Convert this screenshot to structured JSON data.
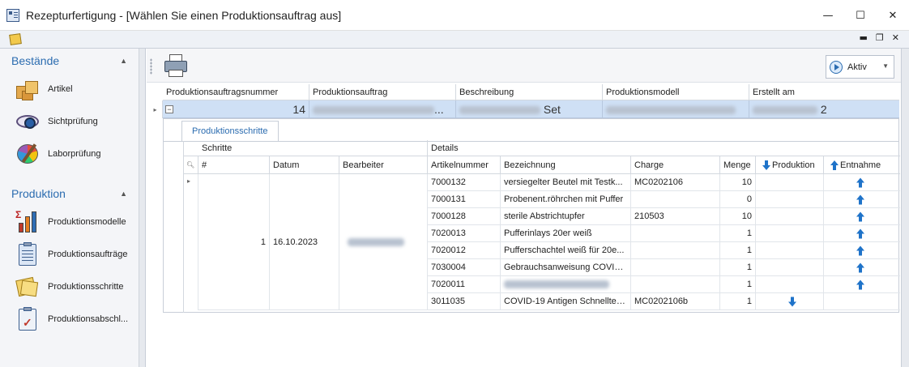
{
  "window": {
    "title": "Rezepturfertigung - [Wählen Sie einen Produktionsauftrag aus]"
  },
  "win_controls": {
    "minimize": "—",
    "maximize": "☐",
    "close": "✕"
  },
  "mdi_controls": {
    "minimize": "▬",
    "restore": "❐",
    "close": "✕"
  },
  "nav": {
    "groups": [
      {
        "title": "Bestände",
        "items": [
          "Artikel",
          "Sichtprüfung",
          "Laborprüfung"
        ]
      },
      {
        "title": "Produktion",
        "items": [
          "Produktionsmodelle",
          "Produktionsaufträge",
          "Produktionsschritte",
          "Produktionsabschl..."
        ]
      }
    ]
  },
  "toolbar": {
    "status_value": "Aktiv"
  },
  "master": {
    "columns": [
      "Produktionsauftragsnummer",
      "Produktionsauftrag",
      "Beschreibung",
      "Produktionsmodell",
      "Erstellt am"
    ],
    "row": {
      "number_visible": "14",
      "description_suffix": "Set",
      "order_suffix": "...",
      "created_suffix": "2"
    }
  },
  "detail": {
    "tab": "Produktionsschritte",
    "band_schritte": "Schritte",
    "band_details": "Details",
    "columns": [
      "#",
      "Datum",
      "Bearbeiter",
      "Artikelnummer",
      "Bezeichnung",
      "Charge",
      "Menge",
      "Produktion",
      "Entnahme"
    ],
    "step": {
      "number": "1",
      "date": "16.10.2023"
    },
    "rows": [
      {
        "artikelnummer": "7000132",
        "bezeichnung": "versiegelter Beutel mit Testk...",
        "charge": "MC0202106",
        "menge": "10",
        "richtung": "entnahme"
      },
      {
        "artikelnummer": "7000131",
        "bezeichnung": "Probenent.röhrchen mit Puffer",
        "charge": "",
        "menge": "0",
        "richtung": "entnahme"
      },
      {
        "artikelnummer": "7000128",
        "bezeichnung": "sterile Abstrichtupfer",
        "charge": "210503",
        "menge": "10",
        "richtung": "entnahme"
      },
      {
        "artikelnummer": "7020013",
        "bezeichnung": "Pufferinlays 20er weiß",
        "charge": "",
        "menge": "1",
        "richtung": "entnahme"
      },
      {
        "artikelnummer": "7020012",
        "bezeichnung": "Pufferschachtel weiß für 20e...",
        "charge": "",
        "menge": "1",
        "richtung": "entnahme"
      },
      {
        "artikelnummer": "7030004",
        "bezeichnung": "Gebrauchsanweisung COVID-...",
        "charge": "",
        "menge": "1",
        "richtung": "entnahme"
      },
      {
        "artikelnummer": "7020011",
        "bezeichnung": "",
        "charge": "",
        "menge": "1",
        "richtung": "entnahme"
      },
      {
        "artikelnummer": "3011035",
        "bezeichnung": "COVID-19 Antigen Schnelltes...",
        "charge": "MC0202106b",
        "menge": "1",
        "richtung": "produktion"
      }
    ]
  },
  "colors": {
    "accent": "#2b6cb0",
    "selected_row": "#cfe0f5",
    "arrow": "#1f73c9"
  }
}
